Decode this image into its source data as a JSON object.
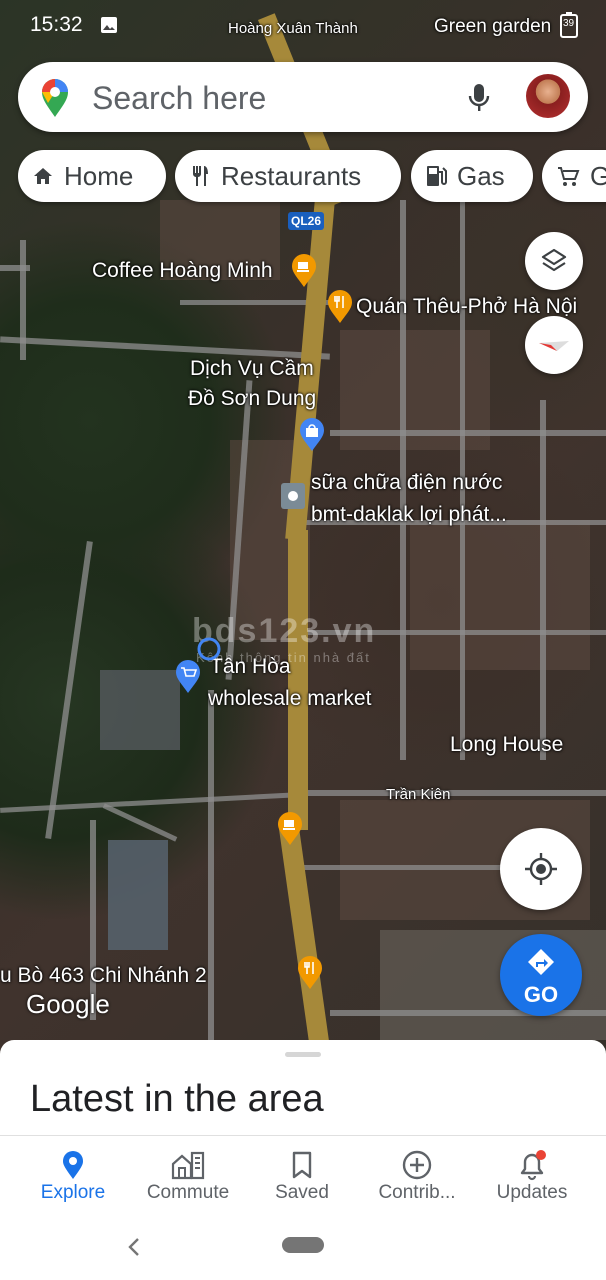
{
  "status_bar": {
    "time": "15:32",
    "battery": "39"
  },
  "map_labels": {
    "top_street": "Hoàng Xuân Thành",
    "green_garden": "Green garden",
    "road_code": "QL26",
    "coffee": "Coffee Hoàng Minh",
    "pho": "Quán Thêu-Phở Hà Nội",
    "pawn_line1": "Dịch Vụ Cầm",
    "pawn_line2": "Đồ Sơn Dung",
    "repair_line1": "sữa chữa điện nước",
    "repair_line2": "bmt-daklak lợi phát...",
    "market_line1": "Tân Hòa",
    "market_line2": "wholesale market",
    "long_house": "Long House",
    "tran_kien": "Trần Kiên",
    "branch": "u Bò 463 Chi Nhánh 2",
    "google": "Google",
    "watermark": "bds123.vn",
    "watermark_sub": "Kênh thông tin nhà đất"
  },
  "search": {
    "placeholder": "Search here"
  },
  "chips": [
    {
      "label": "Home",
      "icon": "home-icon"
    },
    {
      "label": "Restaurants",
      "icon": "fork-knife-icon"
    },
    {
      "label": "Gas",
      "icon": "gas-pump-icon"
    },
    {
      "label": "G",
      "icon": "cart-icon"
    }
  ],
  "go_button": {
    "label": "GO"
  },
  "sheet": {
    "title": "Latest in the area"
  },
  "bottom_nav": [
    {
      "label": "Explore",
      "icon": "pin-icon",
      "active": true
    },
    {
      "label": "Commute",
      "icon": "commute-icon",
      "active": false
    },
    {
      "label": "Saved",
      "icon": "bookmark-icon",
      "active": false
    },
    {
      "label": "Contrib...",
      "icon": "add-circle-icon",
      "active": false
    },
    {
      "label": "Updates",
      "icon": "bell-icon",
      "active": false
    }
  ],
  "colors": {
    "accent": "#1a73e8",
    "main_road": "#a6893a",
    "pin_orange": "#f29900",
    "pin_blue": "#4285f4"
  }
}
